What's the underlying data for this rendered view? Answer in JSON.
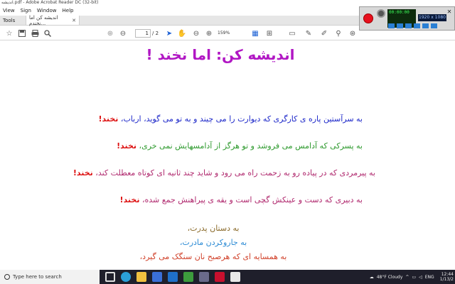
{
  "window": {
    "title": "اندیشه.pdf - Adobe Acrobat Reader DC (32-bit)"
  },
  "menu": [
    "View",
    "Sign",
    "Window",
    "Help"
  ],
  "tabs": {
    "tools": "Tools",
    "document": "اندیشه کن اما نخندم..."
  },
  "toolbar": {
    "page_current": "1",
    "page_total": "/ 2",
    "zoom": "159%"
  },
  "recorder": {
    "display_line1": "00:00:00",
    "display_line2": "",
    "resolution": "1920 x 1080"
  },
  "document": {
    "title": "اندیشه کن: اما نخند !",
    "lines": [
      {
        "text": "به سرآستین پاره ی کارگری که دیوارت را می چیند و به تو می گوید، ارباب، ",
        "bang": "نخند!",
        "color": "#1d28c9"
      },
      {
        "text": "به پسرکی که آدامس می فروشد و تو هرگز از آدامسهایش نمی خری، ",
        "bang": "نخند!",
        "color": "#2e9a2e"
      },
      {
        "text": "به پیرمردی که در پیاده رو به زحمت راه می رود و شاید چند ثانیه ای کوتاه معطلت کند، ",
        "bang": "نخند!",
        "color": "#b0296e"
      },
      {
        "text": "به دبیری که دست و عینکش گچی است و یقه ی پیراهنش جمع شده، ",
        "bang": "نخند!",
        "color": "#b0296e"
      }
    ],
    "centered": [
      {
        "text": "به دستان پدرت،",
        "color": "#8a6a2a"
      },
      {
        "text": "به جاروکردن مادرت،",
        "color": "#2a8ad4"
      },
      {
        "text": "به همسایه ای که هرصبح نان سنگک می گیرد،",
        "color": "#d1422b"
      }
    ]
  },
  "taskbar": {
    "search_placeholder": "Type here to search",
    "weather": "48°F  Cloudy",
    "lang": "ENG",
    "time": "12:44",
    "date": "1/13/2"
  },
  "icons": [
    "search-icon",
    "home-icon",
    "star-icon",
    "print-icon",
    "zoom-out-icon",
    "pointer-icon",
    "hand-icon",
    "zoom-in-icon"
  ]
}
